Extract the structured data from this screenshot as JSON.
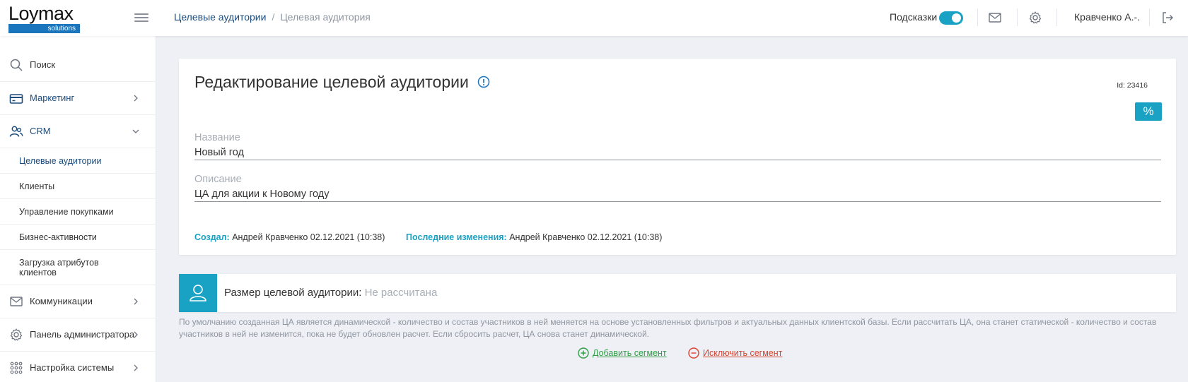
{
  "logo": {
    "word": "Loymax",
    "sub": "solutions"
  },
  "breadcrumb": {
    "items": [
      "Целевые аудитории"
    ],
    "separator": "/",
    "current": "Целевая аудитория"
  },
  "header": {
    "hints_label": "Подсказки",
    "hints_enabled": true,
    "user_name": "Кравченко А.-."
  },
  "sidebar": {
    "items": [
      {
        "label": "Поиск",
        "icon": "search-icon"
      },
      {
        "label": "Маркетинг",
        "icon": "card-icon",
        "chevron": "right"
      },
      {
        "label": "CRM",
        "icon": "users-icon",
        "chevron": "down"
      }
    ],
    "crm_sub": [
      {
        "label": "Целевые аудитории",
        "active": true
      },
      {
        "label": "Клиенты"
      },
      {
        "label": "Управление покупками"
      },
      {
        "label": "Бизнес-активности"
      },
      {
        "label": "Загрузка атрибутов клиентов"
      }
    ],
    "bottom_items": [
      {
        "label": "Коммуникации",
        "icon": "mail-icon"
      },
      {
        "label": "Панель администратора",
        "icon": "gear-icon"
      },
      {
        "label": "Настройка системы",
        "icon": "grid-icon"
      }
    ]
  },
  "card": {
    "title": "Редактирование целевой аудитории",
    "id_text": "Id: 23416",
    "percent_button": "%",
    "name_label": "Название",
    "name_value": "Новый год",
    "description_label": "Описание",
    "description_value": "ЦА для акции к Новому году",
    "created_key": "Создал:",
    "created_value": "Андрей Кравченко 02.12.2021 (10:38)",
    "modified_key": "Последние изменения:",
    "modified_value": "Андрей Кравченко 02.12.2021 (10:38)"
  },
  "audience": {
    "size_label": "Размер целевой аудитории:",
    "size_value": "Не рассчитана",
    "note": "По умолчанию созданная ЦА является динамической - количество и состав участников в ней меняется на основе установленных фильтров и актуальных данных клиентской базы. Если рассчитать ЦА, она станет статической - количество и состав участников в ней не изменится, пока не будет обновлен расчет. Если сбросить расчет, ЦА снова станет динамической.",
    "add_segment": "Добавить сегмент",
    "exclude_segment": "Исключить сегмент"
  },
  "colors": {
    "accent": "#1aa2c4",
    "brand": "#1b75bc",
    "link": "#1c4c7d",
    "add": "#2f9e44",
    "exclude": "#d9432f"
  }
}
